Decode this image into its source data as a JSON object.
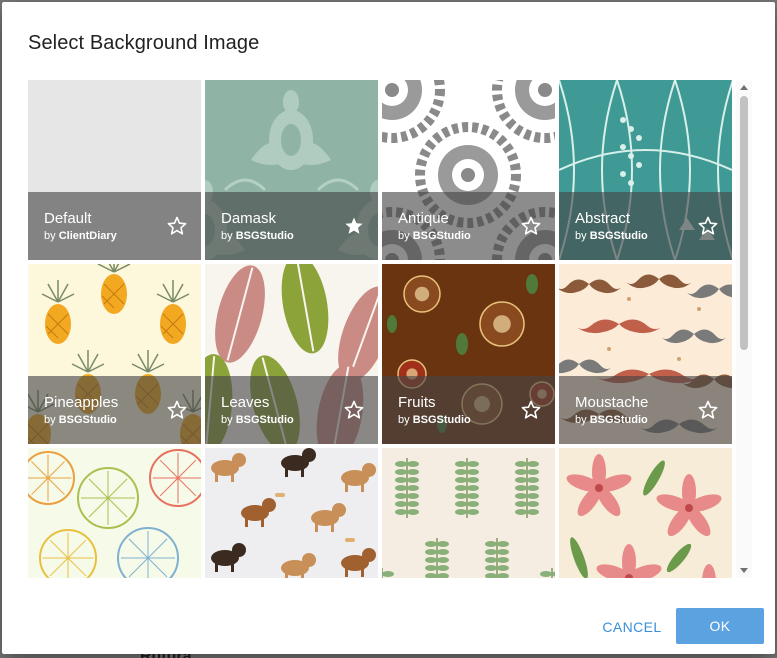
{
  "dialog": {
    "title": "Select Background Image",
    "cancel_label": "CANCEL",
    "ok_label": "OK"
  },
  "backdrop": {
    "peek_text": "Rutura"
  },
  "tiles": [
    {
      "name": "Default",
      "by_prefix": "by",
      "author": "ClientDiary",
      "favorite": false,
      "pattern": "default"
    },
    {
      "name": "Damask",
      "by_prefix": "by",
      "author": "BSGStudio",
      "favorite": true,
      "pattern": "damask"
    },
    {
      "name": "Antique",
      "by_prefix": "by",
      "author": "BSGStudio",
      "favorite": false,
      "pattern": "antique"
    },
    {
      "name": "Abstract",
      "by_prefix": "by",
      "author": "BSGStudio",
      "favorite": false,
      "pattern": "abstract"
    },
    {
      "name": "Pineapples",
      "by_prefix": "by",
      "author": "BSGStudio",
      "favorite": false,
      "pattern": "pineapples"
    },
    {
      "name": "Leaves",
      "by_prefix": "by",
      "author": "BSGStudio",
      "favorite": false,
      "pattern": "leaves"
    },
    {
      "name": "Fruits",
      "by_prefix": "by",
      "author": "BSGStudio",
      "favorite": false,
      "pattern": "fruits"
    },
    {
      "name": "Moustache",
      "by_prefix": "by",
      "author": "BSGStudio",
      "favorite": false,
      "pattern": "moustache"
    },
    {
      "pattern": "citrus"
    },
    {
      "pattern": "dogs"
    },
    {
      "pattern": "sprigs"
    },
    {
      "pattern": "lilies"
    }
  ],
  "icons": {
    "star_empty": "star-outline-icon",
    "star_filled": "star-filled-icon"
  },
  "colors": {
    "accent": "#3a8fd8",
    "ok_button": "#5aa2e0",
    "caption_overlay": "rgba(70,70,70,0.62)"
  }
}
